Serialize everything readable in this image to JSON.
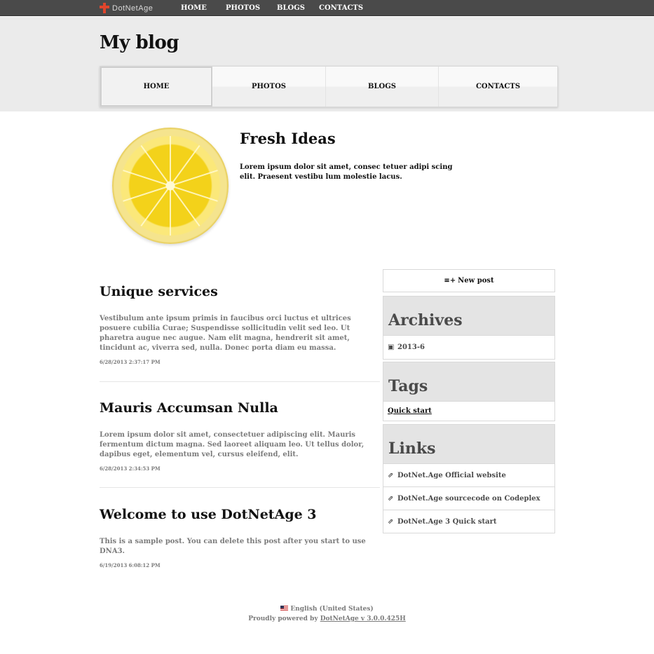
{
  "topbar": {
    "brand": "DotNetAge",
    "nav": [
      "HOME",
      "PHOTOS",
      "BLOGS",
      "CONTACTS"
    ]
  },
  "header": {
    "title": "My blog",
    "nav": [
      "HOME",
      "PHOTOS",
      "BLOGS",
      "CONTACTS"
    ]
  },
  "hero": {
    "title": "Fresh Ideas",
    "text": "Lorem ipsum dolor sit amet, consec tetuer adipi scing elit. Praesent vestibu lum molestie lacus."
  },
  "posts": [
    {
      "title": "Unique services",
      "body": "Vestibulum ante ipsum primis in faucibus orci luctus et ultrices posuere cubilia Curae; Suspendisse sollicitudin velit sed leo. Ut pharetra augue nec augue. Nam elit magna, hendrerit sit amet, tincidunt ac, viverra sed, nulla. Donec porta diam eu massa.",
      "date": "6/28/2013 2:37:17 PM"
    },
    {
      "title": "Mauris Accumsan Nulla",
      "body": "Lorem ipsum dolor sit amet, consectetuer adipiscing elit. Mauris fermentum dictum magna. Sed laoreet aliquam leo. Ut tellus dolor, dapibus eget, elementum vel, cursus eleifend, elit.",
      "date": "6/28/2013 2:34:53 PM"
    },
    {
      "title": "Welcome to use DotNetAge 3",
      "body": "This is a sample post. You can delete this post after you start to use DNA3.",
      "date": "6/19/2013 6:08:12 PM"
    }
  ],
  "sidebar": {
    "new_post": "New post",
    "archives": {
      "title": "Archives",
      "items": [
        "2013-6"
      ]
    },
    "tags": {
      "title": "Tags",
      "items": [
        "Quick start"
      ]
    },
    "links": {
      "title": "Links",
      "items": [
        "DotNet.Age Official website",
        "DotNet.Age sourcecode on Codeplex",
        "DotNet.Age 3 Quick start"
      ]
    }
  },
  "footer": {
    "language": "English (United States)",
    "powered_prefix": "Proudly powered by",
    "powered_link": "DotNetAge v 3.0.0.425H"
  },
  "colors": {
    "topbar": "#4a4a4a",
    "header_band": "#ebebeb",
    "brand_icon": "#e0452c",
    "muted_text": "#7b7b7b"
  }
}
